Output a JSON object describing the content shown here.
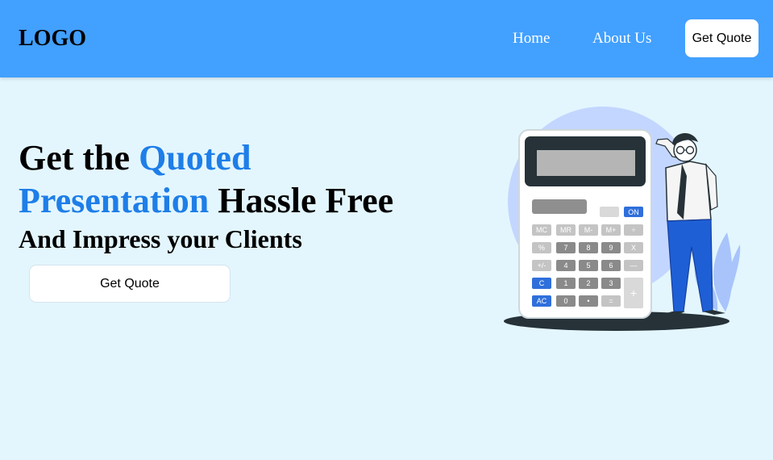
{
  "header": {
    "logo": "LOGO",
    "nav": {
      "home": "Home",
      "about": "About Us"
    },
    "cta": "Get Quote"
  },
  "hero": {
    "line1_plain": "Get the ",
    "line1_accent": "Quoted",
    "line2_accent": "Presentation",
    "line2_plain": " Hassle Free",
    "subheading": "And Impress your Clients",
    "cta": "Get Quote"
  },
  "illustration": {
    "keys": {
      "on": "ON",
      "mc": "MC",
      "mr": "MR",
      "mminus": "M-",
      "mplus": "M+",
      "div": "÷",
      "pct": "%",
      "k7": "7",
      "k8": "8",
      "k9": "9",
      "mul": "X",
      "pm": "+/-",
      "k4": "4",
      "k5": "5",
      "k6": "6",
      "minus": "—",
      "c": "C",
      "k1": "1",
      "k2": "2",
      "k3": "3",
      "plus": "+",
      "ac": "AC",
      "k0": "0",
      "dot": "•",
      "eq": "="
    }
  },
  "colors": {
    "nav": "#42a0ff",
    "background": "#e3f6fe",
    "accent": "#1e7ee8"
  }
}
